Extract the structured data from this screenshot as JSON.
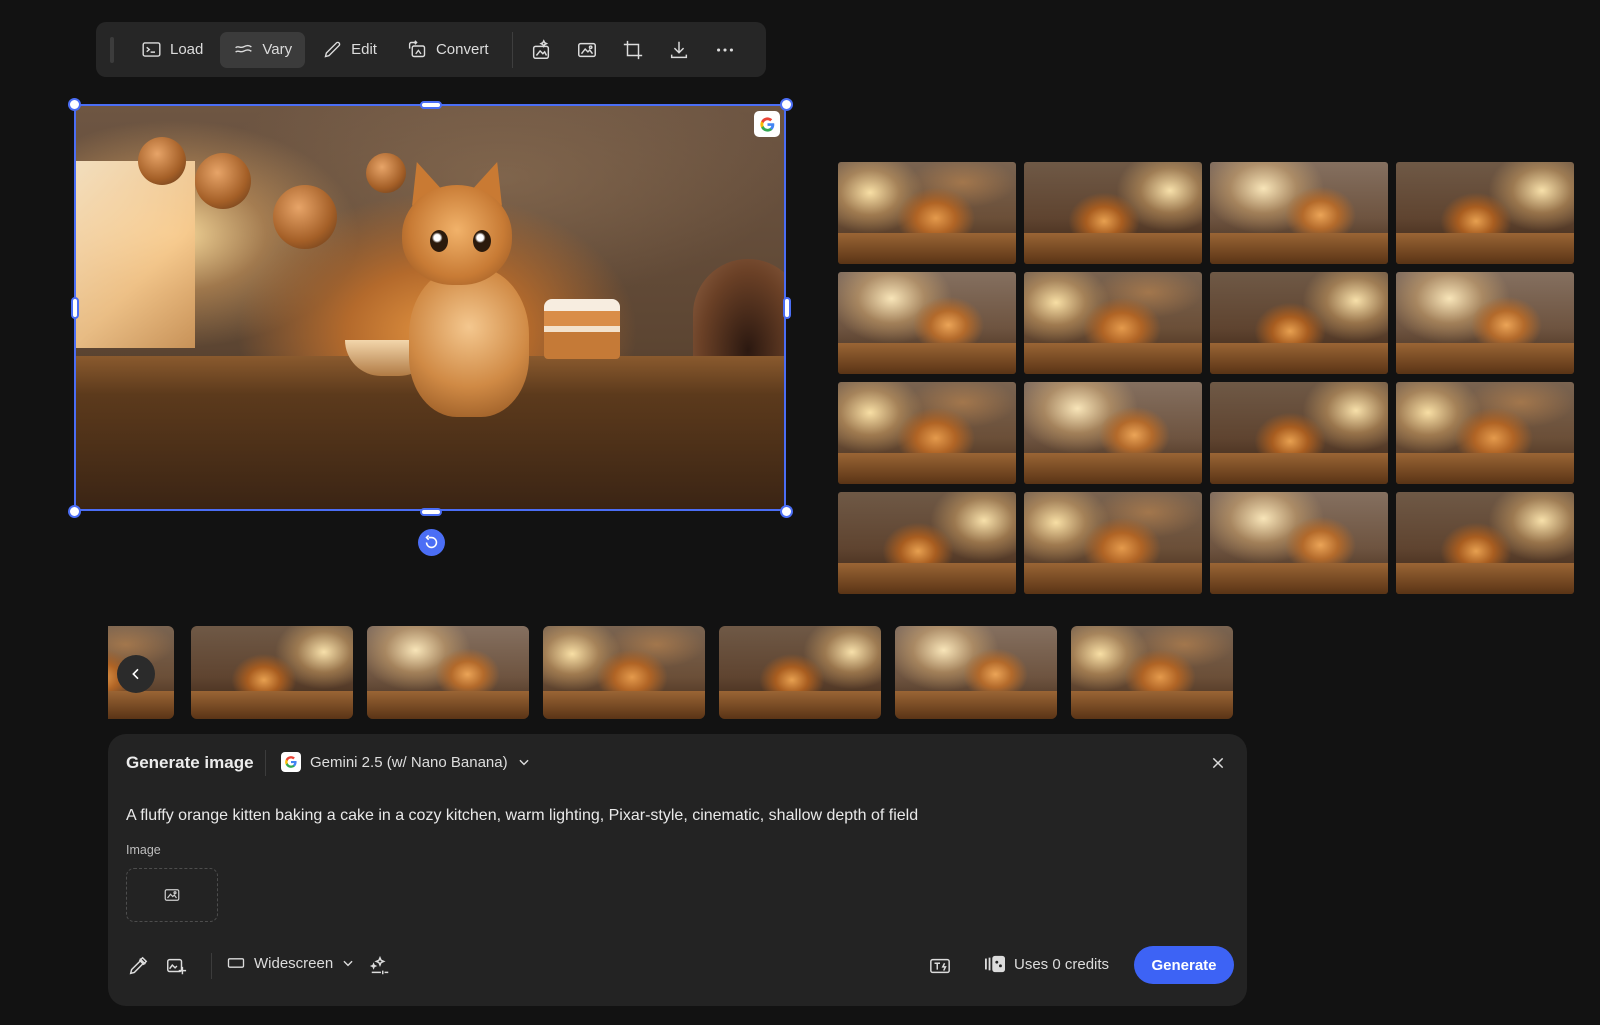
{
  "toolbar": {
    "load_label": "Load",
    "vary_label": "Vary",
    "edit_label": "Edit",
    "convert_label": "Convert",
    "icons": [
      "magic-image-icon",
      "image-icon",
      "crop-icon",
      "download-icon",
      "more-icon"
    ]
  },
  "canvas": {
    "image_description_icon": "google-g-icon",
    "accent": "#4b6ef5"
  },
  "variations": {
    "count": 16
  },
  "history": {
    "count": 7
  },
  "generate_panel": {
    "title": "Generate image",
    "model": "Gemini 2.5 (w/ Nano Banana)",
    "prompt": "A fluffy orange kitten baking a cake in a cozy kitchen, warm lighting, Pixar-style, cinematic, shallow depth of field",
    "image_label": "Image",
    "aspect_ratio": "Widescreen",
    "credits": "Uses 0 credits",
    "generate_label": "Generate",
    "button_color": "#3d63f5"
  }
}
